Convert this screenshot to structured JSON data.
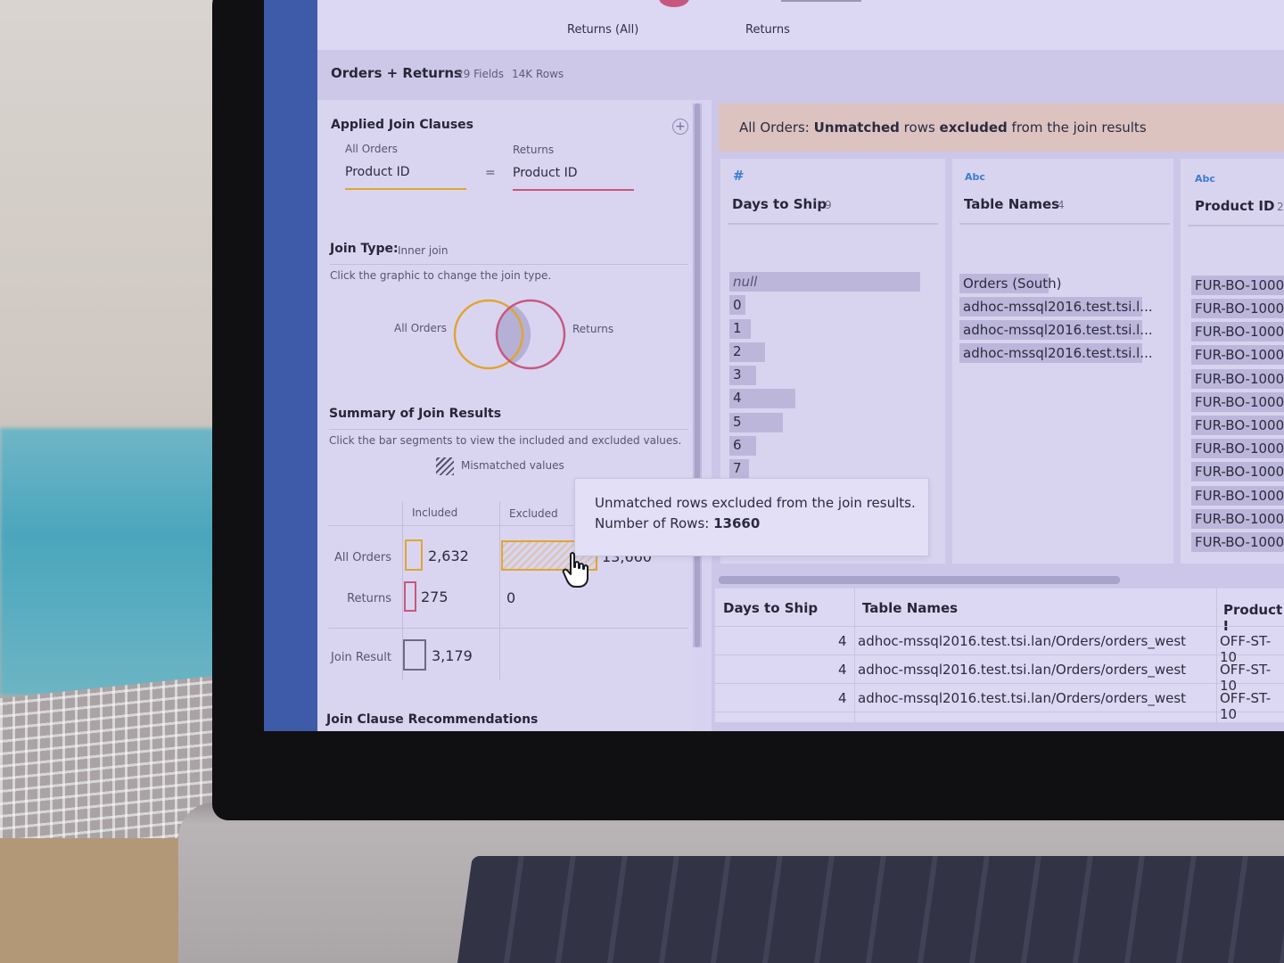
{
  "tabs": [
    {
      "label": "Returns (All)"
    },
    {
      "label": "Returns"
    }
  ],
  "header": {
    "title": "Orders + Returns",
    "fields": "29 Fields",
    "rows": "14K Rows"
  },
  "applied_join_clauses": {
    "title": "Applied Join Clauses",
    "left_table": "All Orders",
    "right_table": "Returns",
    "left_field": "Product ID",
    "operator": "=",
    "right_field": "Product ID"
  },
  "join_type": {
    "label": "Join Type:",
    "value": "Inner join",
    "hint": "Click the graphic to change the join type.",
    "left_label": "All Orders",
    "right_label": "Returns"
  },
  "summary": {
    "title": "Summary of Join Results",
    "hint": "Click the bar segments to view the included and excluded values.",
    "mismatched_label": "Mismatched values",
    "col_included": "Included",
    "col_excluded": "Excluded",
    "rows": [
      {
        "label": "All Orders",
        "included": "2,632",
        "excluded": "13,660"
      },
      {
        "label": "Returns",
        "included": "275",
        "excluded": "0"
      },
      {
        "label": "Join Result",
        "included": "3,179"
      }
    ]
  },
  "recommendations_title": "Join Clause Recommendations",
  "banner": {
    "prefix": "All Orders: ",
    "bold1": "Unmatched",
    "mid": " rows ",
    "bold2": "excluded",
    "suffix": " from the join results"
  },
  "profile_cards": [
    {
      "type": "#",
      "title": "Days to Ship",
      "count": "9",
      "values": [
        "null",
        "0",
        "1",
        "2",
        "3",
        "4",
        "5",
        "6",
        "7"
      ]
    },
    {
      "type": "Abc",
      "title": "Table Names",
      "count": "4",
      "values": [
        "Orders (South)",
        "adhoc-mssql2016.test.tsi.l...",
        "adhoc-mssql2016.test.tsi.l...",
        "adhoc-mssql2016.test.tsi.l..."
      ]
    },
    {
      "type": "Abc",
      "title": "Product ID",
      "count": "2",
      "values": [
        "FUR-BO-1000",
        "FUR-BO-1000",
        "FUR-BO-1000",
        "FUR-BO-1000",
        "FUR-BO-1000",
        "FUR-BO-1000",
        "FUR-BO-1000",
        "FUR-BO-1000",
        "FUR-BO-1000",
        "FUR-BO-1000",
        "FUR-BO-1000",
        "FUR-BO-1000"
      ]
    }
  ],
  "tooltip": {
    "line1": "Unmatched rows excluded from the join results.",
    "line2_label": "Number of Rows: ",
    "line2_value": "13660"
  },
  "grid": {
    "headers": [
      "Days to Ship",
      "Table Names",
      "Product I"
    ],
    "rows": [
      [
        "4",
        "adhoc-mssql2016.test.tsi.lan/Orders/orders_west",
        "OFF-ST-10"
      ],
      [
        "4",
        "adhoc-mssql2016.test.tsi.lan/Orders/orders_west",
        "OFF-ST-10"
      ],
      [
        "4",
        "adhoc-mssql2016.test.tsi.lan/Orders/orders_west",
        "OFF-ST-10"
      ]
    ]
  },
  "colors": {
    "orange": "#e0a52f",
    "pink": "#c8577f",
    "rail": "#3d5ba8",
    "banner": "#dcc3c0"
  }
}
